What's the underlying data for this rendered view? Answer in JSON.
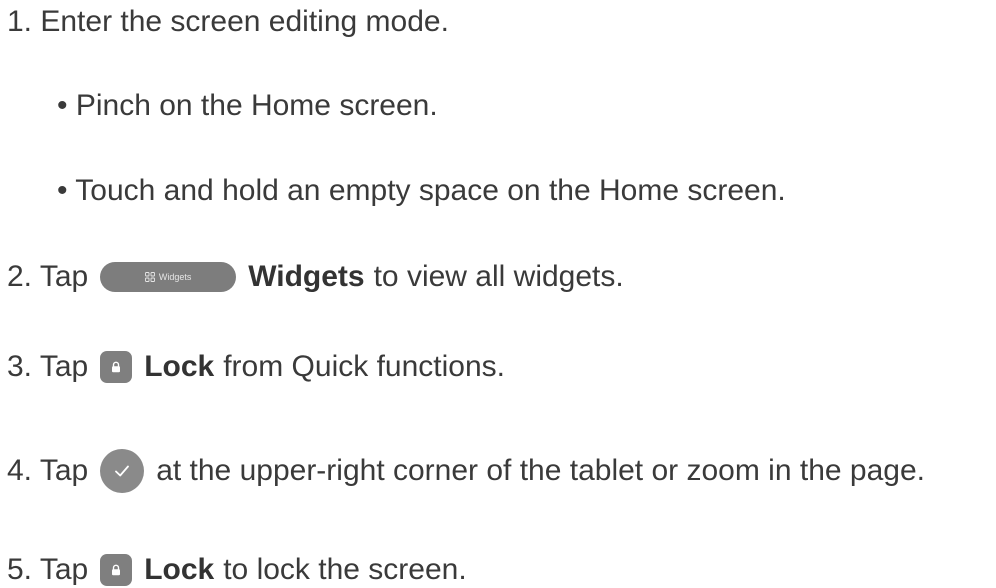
{
  "steps": {
    "s1": {
      "text": "1. Enter the screen editing mode."
    },
    "s1a": {
      "text": "• Pinch on the Home screen."
    },
    "s1b": {
      "text": "• Touch and hold an empty space on the Home screen."
    },
    "s2": {
      "prefix": "2. Tap",
      "pill_label": "Widgets",
      "bold": "Widgets",
      "suffix": " to view all widgets."
    },
    "s3": {
      "prefix": "3. Tap",
      "bold": "Lock",
      "suffix": " from Quick functions."
    },
    "s4": {
      "prefix": "4. Tap",
      "suffix": "at the upper-right corner of the tablet or zoom in the page."
    },
    "s5": {
      "prefix": "5. Tap",
      "bold": "Lock",
      "suffix": " to lock the screen."
    }
  },
  "icons": {
    "widgets_grid": "grid-icon",
    "lock": "lock-icon",
    "confirm": "checkmark-icon"
  },
  "colors": {
    "text": "#3a3a3a",
    "icon_bg": "#7f7f7f",
    "icon_fg": "#ffffff"
  }
}
